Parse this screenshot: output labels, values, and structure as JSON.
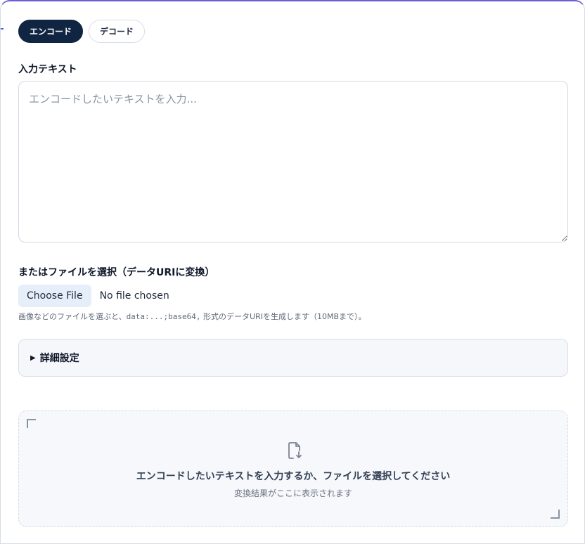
{
  "tabs": [
    {
      "label": "エンコード",
      "active": true
    },
    {
      "label": "デコード",
      "active": false
    }
  ],
  "input": {
    "label": "入力テキスト",
    "placeholder": "エンコードしたいテキストを入力...",
    "value": ""
  },
  "file": {
    "label": "またはファイルを選択（データURIに変換）",
    "button_label": "Choose File",
    "status": "No file chosen",
    "hint_prefix": "画像などのファイルを選ぶと、",
    "hint_code": "data:...;base64,",
    "hint_suffix": " 形式のデータURIを生成します（10MBまで）。"
  },
  "details": {
    "label": "詳細設定",
    "marker": "▶"
  },
  "result": {
    "icon": "file-download-icon",
    "title": "エンコードしたいテキストを入力するか、ファイルを選択してください",
    "subtitle": "変換結果がここに表示されます"
  },
  "colors": {
    "active_tab": "#0f2542",
    "accent_border": "#6a5fd0",
    "choose_button_bg": "#e6eef9"
  }
}
